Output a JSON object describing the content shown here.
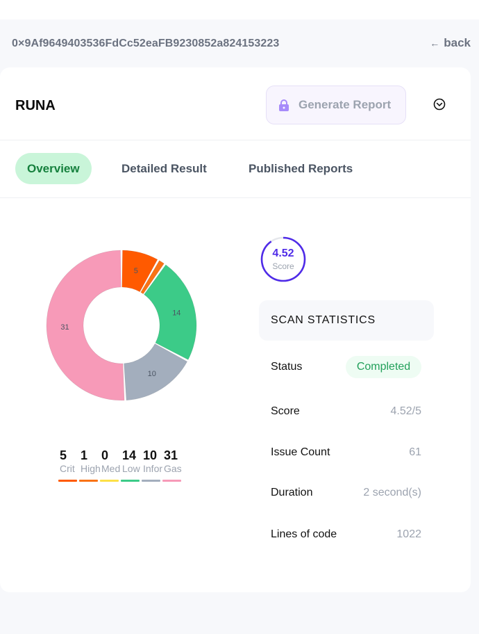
{
  "header": {
    "address": "0×9Af9649403536FdCc52eaFB9230852a824153223",
    "back_label": "back",
    "back_arrow": "←"
  },
  "project": {
    "name": "RUNA",
    "generate_label": "Generate Report"
  },
  "tabs": [
    {
      "label": "Overview",
      "active": true
    },
    {
      "label": "Detailed Result",
      "active": false
    },
    {
      "label": "Published Reports",
      "active": false
    }
  ],
  "severity": [
    {
      "count": 5,
      "label": "Crit",
      "color": "#ff5a00"
    },
    {
      "count": 1,
      "label": "High",
      "color": "#f97316"
    },
    {
      "count": 0,
      "label": "Med",
      "color": "#fde047"
    },
    {
      "count": 14,
      "label": "Low",
      "color": "#3ccb88"
    },
    {
      "count": 10,
      "label": "Infor",
      "color": "#a3aebd"
    },
    {
      "count": 31,
      "label": "Gas",
      "color": "#f79ab8"
    }
  ],
  "gauge": {
    "value": "4.52",
    "label": "Score",
    "fraction": 0.904,
    "color": "#4f2be8"
  },
  "stats": {
    "title": "SCAN STATISTICS",
    "status_label": "Status",
    "status_value": "Completed",
    "score_label": "Score",
    "score_value": "4.52/5",
    "issue_label": "Issue Count",
    "issue_value": "61",
    "duration_label": "Duration",
    "duration_value": "2 second(s)",
    "loc_label": "Lines of code",
    "loc_value": "1022"
  }
}
